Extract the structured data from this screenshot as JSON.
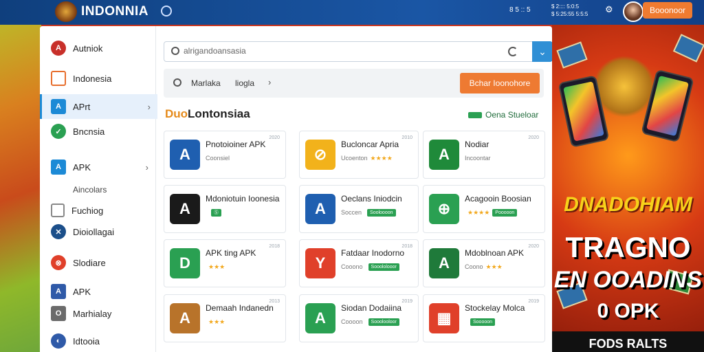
{
  "header": {
    "brand": "INDONNIA",
    "stats": "8 5 :: 5",
    "notice": "$ 2:::: 5:0:5",
    "notice2": "$ 5:25:55 5:5:5",
    "user_button": "Booonoor"
  },
  "sidebar": {
    "items": [
      {
        "label": "Autniok",
        "icon": "a-logo-icon",
        "color": "#c8302a"
      },
      {
        "label": "Indonesia",
        "icon": "square-icon",
        "color": "#e76e2d"
      },
      {
        "label": "APrt",
        "icon": "apk-icon",
        "color": "#1c8ad6",
        "active": true
      },
      {
        "label": "Bncnsia",
        "icon": "check-icon",
        "color": "#2aa052"
      },
      {
        "label": "APK",
        "icon": "apk-icon",
        "color": "#1c8ad6"
      },
      {
        "label": "Aincolars",
        "icon": "",
        "color": ""
      },
      {
        "label": "Fuchiog",
        "icon": "box-icon",
        "color": "#888888"
      },
      {
        "label": "Dioiollagai",
        "icon": "x-icon",
        "color": "#1c4f8a"
      },
      {
        "label": "Slodiare",
        "icon": "x-circle-icon",
        "color": "#e0402a"
      },
      {
        "label": "APK",
        "icon": "apk-icon",
        "color": "#2f5aa8"
      },
      {
        "label": "Marhialay",
        "icon": "o-icon",
        "color": "#6b6b6b"
      },
      {
        "label": "Idtooia",
        "icon": "globe-icon",
        "color": "#2f5aa8"
      }
    ]
  },
  "search": {
    "placeholder": "alrigandoansasia"
  },
  "filter": {
    "label1": "Marlaka",
    "label2": "liogla",
    "download_button": "Bchar Ioonohore"
  },
  "section": {
    "title_accent": "Duo",
    "title_rest": "Lontonsiaa",
    "link": "Oena Stueloar"
  },
  "cards": [
    {
      "title": "Pnotoioiner APK",
      "sub": "Coonsiel",
      "num": "2020",
      "color": "#1f5fb0",
      "glyph": "A",
      "stars": "",
      "badge": ""
    },
    {
      "title": "Bucloncar Apria",
      "sub": "Ucoenton",
      "num": "2010",
      "color": "#f2b21b",
      "glyph": "⊘",
      "stars": "★★★★",
      "badge": ""
    },
    {
      "title": "Nodiar",
      "sub": "Incoontar",
      "num": "2020",
      "color": "#1f8a3a",
      "glyph": "A",
      "stars": "",
      "badge": ""
    },
    {
      "title": "Mdoniotuin Ioonesia",
      "sub": "",
      "num": "",
      "color": "#1a1a1a",
      "glyph": "A",
      "stars": "",
      "badge": "Ⓢ"
    },
    {
      "title": "Oeclans Iniodcin",
      "sub": "Soccen",
      "num": "",
      "color": "#1f5fb0",
      "glyph": "A",
      "stars": "",
      "badge": "Sooloooon"
    },
    {
      "title": "Acagooin Boosian",
      "sub": "",
      "num": "",
      "color": "#2aa052",
      "glyph": "⊕",
      "stars": "★★★★",
      "badge": "Pooooon"
    },
    {
      "title": "APK ting APK",
      "sub": "",
      "num": "2018",
      "color": "#2aa052",
      "glyph": "D",
      "stars": "★★★",
      "badge": ""
    },
    {
      "title": "Fatdaar Inodorno",
      "sub": "Cooono",
      "num": "2018",
      "color": "#e0402a",
      "glyph": "Y",
      "stars": "",
      "badge": "Sooololooor"
    },
    {
      "title": "Mdoblnoan APK",
      "sub": "Coono",
      "num": "2020",
      "color": "#1f7a3a",
      "glyph": "A",
      "stars": "★★★",
      "badge": ""
    },
    {
      "title": "Demaah Indanedn",
      "sub": "",
      "num": "2013",
      "color": "#b8732a",
      "glyph": "A",
      "stars": "★★★",
      "badge": ""
    },
    {
      "title": "Siodan Dodaiina",
      "sub": "Coooon",
      "num": "2019",
      "color": "#2aa052",
      "glyph": "A",
      "stars": "",
      "badge": "Sooolooloor"
    },
    {
      "title": "Stockelay Molca",
      "sub": "",
      "num": "2019",
      "color": "#e0402a",
      "glyph": "▦",
      "stars": "",
      "badge": "Sooooon"
    }
  ],
  "promo": {
    "line1": "DNADOHIAM",
    "line2": "TRAGNO",
    "line3": "EN OOADINS",
    "line4": "0 OPK",
    "bar": "FODS RALTS"
  }
}
